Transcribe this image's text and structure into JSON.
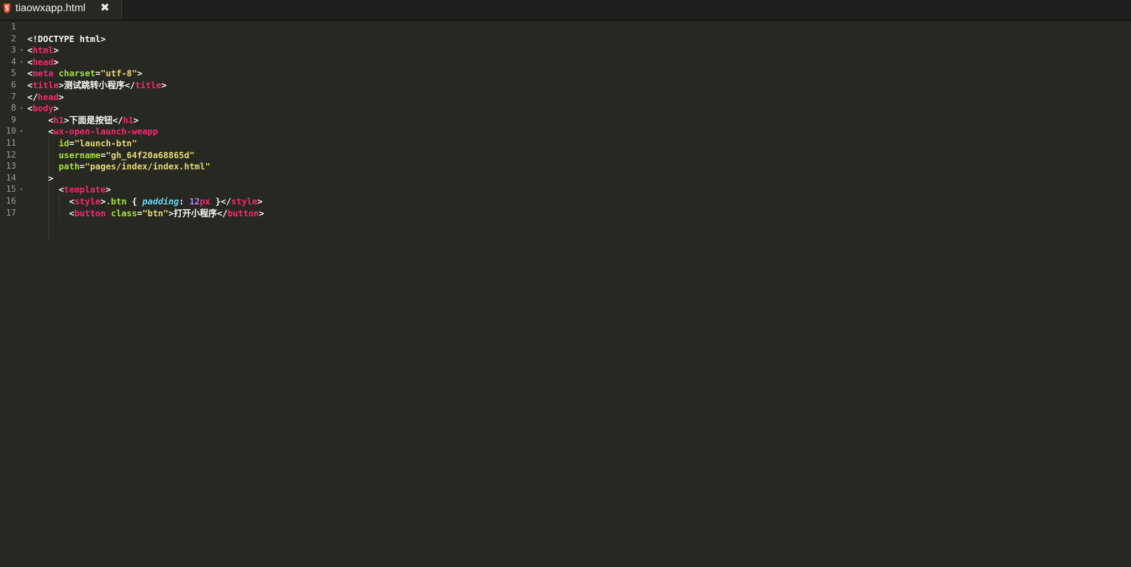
{
  "tab": {
    "title": "tiaowxapp.html",
    "icon": "html5-icon",
    "close_icon": "close-icon",
    "close_glyph": "✖"
  },
  "editor": {
    "current_line": 22,
    "lines": [
      {
        "n": "1",
        "fold": false,
        "indent": 0,
        "tokens": []
      },
      {
        "n": "2",
        "fold": false,
        "indent": 0,
        "tokens": [
          [
            "pl",
            "<!DOCTYPE html>"
          ]
        ]
      },
      {
        "n": "3",
        "fold": true,
        "indent": 0,
        "tokens": [
          [
            "pl",
            "<"
          ],
          [
            "tg",
            "html"
          ],
          [
            "pl",
            ">"
          ]
        ]
      },
      {
        "n": "4",
        "fold": true,
        "indent": 0,
        "tokens": [
          [
            "pl",
            "<"
          ],
          [
            "tg",
            "head"
          ],
          [
            "pl",
            ">"
          ]
        ]
      },
      {
        "n": "5",
        "fold": false,
        "indent": 0,
        "tokens": [
          [
            "pl",
            "<"
          ],
          [
            "tg",
            "meta"
          ],
          [
            "pl",
            " "
          ],
          [
            "at",
            "charset"
          ],
          [
            "pl",
            "="
          ],
          [
            "st",
            "\"utf-8\""
          ],
          [
            "pl",
            ">"
          ]
        ]
      },
      {
        "n": "6",
        "fold": false,
        "indent": 0,
        "tokens": [
          [
            "pl",
            "<"
          ],
          [
            "tg",
            "title"
          ],
          [
            "pl",
            ">测试跳转小程序</"
          ],
          [
            "tg",
            "title"
          ],
          [
            "pl",
            ">"
          ]
        ]
      },
      {
        "n": "7",
        "fold": false,
        "indent": 0,
        "tokens": [
          [
            "pl",
            "</"
          ],
          [
            "tg",
            "head"
          ],
          [
            "pl",
            ">"
          ]
        ]
      },
      {
        "n": "8",
        "fold": true,
        "indent": 0,
        "tokens": [
          [
            "pl",
            "<"
          ],
          [
            "tg",
            "body"
          ],
          [
            "pl",
            ">"
          ]
        ]
      },
      {
        "n": "9",
        "fold": false,
        "indent": 4,
        "tokens": [
          [
            "pl",
            "<"
          ],
          [
            "tg",
            "h1"
          ],
          [
            "pl",
            ">下面是按钮</"
          ],
          [
            "tg",
            "h1"
          ],
          [
            "pl",
            ">"
          ]
        ]
      },
      {
        "n": "10",
        "fold": true,
        "indent": 4,
        "tokens": [
          [
            "pl",
            "<"
          ],
          [
            "tg",
            "wx-open-launch-weapp"
          ]
        ]
      },
      {
        "n": "11",
        "fold": false,
        "indent": 6,
        "tokens": [
          [
            "at",
            "id"
          ],
          [
            "pl",
            "="
          ],
          [
            "st",
            "\"launch-btn\""
          ]
        ]
      },
      {
        "n": "12",
        "fold": false,
        "indent": 6,
        "tokens": [
          [
            "at",
            "username"
          ],
          [
            "pl",
            "="
          ],
          [
            "st",
            "\"gh_64f20a68865d\""
          ]
        ]
      },
      {
        "n": "13",
        "fold": false,
        "indent": 6,
        "tokens": [
          [
            "at",
            "path"
          ],
          [
            "pl",
            "="
          ],
          [
            "st",
            "\"pages/index/index.html\""
          ]
        ]
      },
      {
        "n": "14",
        "fold": false,
        "indent": 4,
        "tokens": [
          [
            "pl",
            ">"
          ]
        ]
      },
      {
        "n": "15",
        "fold": true,
        "indent": 6,
        "tokens": [
          [
            "pl",
            "<"
          ],
          [
            "tg",
            "template"
          ],
          [
            "pl",
            ">"
          ]
        ]
      },
      {
        "n": "16",
        "fold": false,
        "indent": 8,
        "tokens": [
          [
            "pl",
            "<"
          ],
          [
            "tg",
            "style"
          ],
          [
            "pl",
            ">"
          ],
          [
            "at",
            ".btn"
          ],
          [
            "pl",
            " { "
          ],
          [
            "kw",
            "padding"
          ],
          [
            "pl",
            ": "
          ],
          [
            "nm",
            "12"
          ],
          [
            "tg",
            "px"
          ],
          [
            "pl",
            " }</"
          ],
          [
            "tg",
            "style"
          ],
          [
            "pl",
            ">"
          ]
        ]
      },
      {
        "n": "17",
        "fold": false,
        "indent": 8,
        "tokens": [
          [
            "pl",
            "<"
          ],
          [
            "tg",
            "button"
          ],
          [
            "pl",
            " "
          ],
          [
            "at",
            "class"
          ],
          [
            "pl",
            "="
          ],
          [
            "st",
            "\"btn\""
          ],
          [
            "pl",
            ">打开小程序</"
          ],
          [
            "tg",
            "button"
          ],
          [
            "pl",
            ">"
          ]
        ]
      }
    ]
  }
}
